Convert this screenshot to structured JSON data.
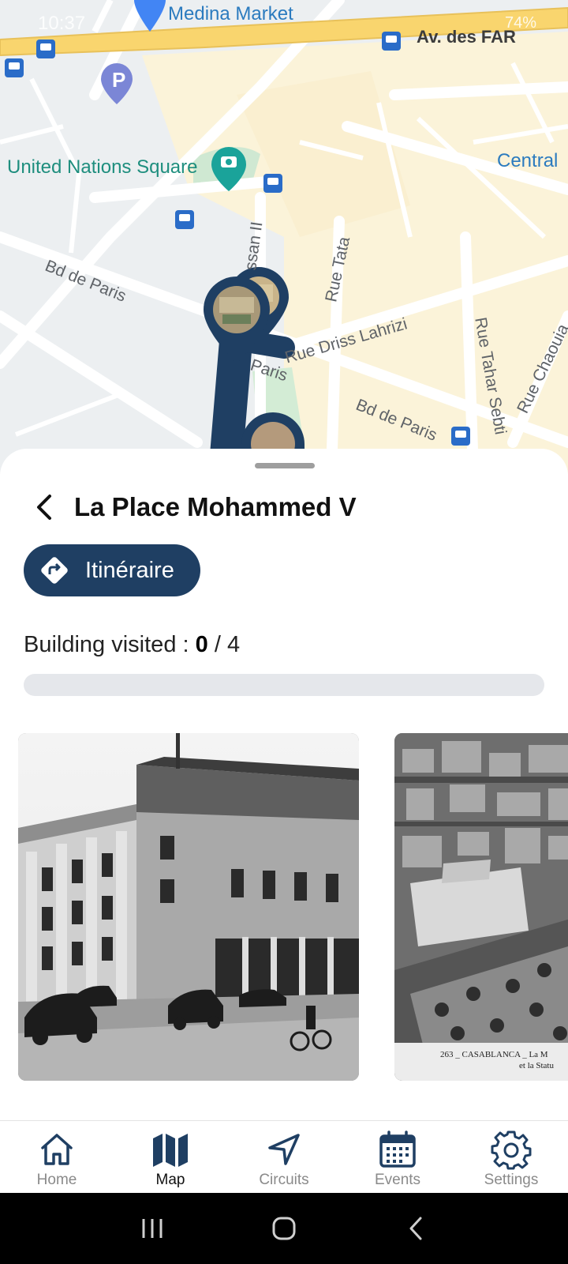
{
  "status_bar": {
    "time": "10:37",
    "right": "74%"
  },
  "map": {
    "poi": [
      {
        "label": "Medina Market"
      },
      {
        "label": "United Nations Square"
      },
      {
        "label": "Central"
      }
    ],
    "streets": {
      "av_far": "Av. des FAR",
      "bd_paris_1": "Bd de Paris",
      "bd_paris_2": "Bd de Paris",
      "bd_paris_3": "Paris",
      "rue_tata": "Rue Tata",
      "rue_driss": "Rue Driss Lahrizi",
      "rue_tahar": "Rue Tahar Sebti",
      "rue_chaouia": "Rue Chaouia",
      "hassan": "ssan II"
    },
    "parking_letter": "P",
    "colors": {
      "route": "#1f3f63",
      "highway": "#f9d56e",
      "land": "#f1f3f4",
      "area": "#fbf3d9",
      "park": "#cfe8d2"
    }
  },
  "sheet": {
    "title": "La Place Mohammed V",
    "itinerary_label": "Itinéraire",
    "visited_prefix": "Building visited : ",
    "visited_count": "0",
    "visited_sep": " / ",
    "visited_total": "4",
    "progress_fraction": 0,
    "photo2_caption_line1": "263 _ CASABLANCA _ La M",
    "photo2_caption_line2": "et la Statu"
  },
  "nav": {
    "items": [
      {
        "label": "Home",
        "icon": "home-icon"
      },
      {
        "label": "Map",
        "icon": "map-icon"
      },
      {
        "label": "Circuits",
        "icon": "navigation-icon"
      },
      {
        "label": "Events",
        "icon": "calendar-icon"
      },
      {
        "label": "Settings",
        "icon": "gear-icon"
      }
    ],
    "active_index": 1,
    "active_color": "#1f3f63",
    "inactive_color": "#1f3f63"
  }
}
